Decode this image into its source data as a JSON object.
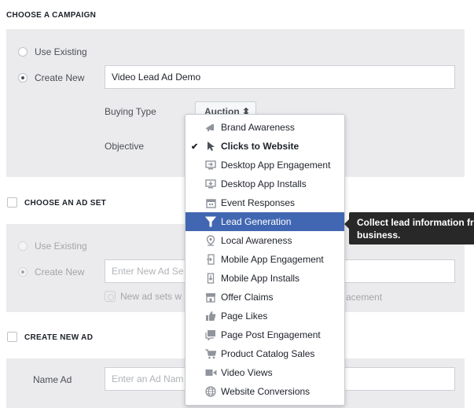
{
  "campaign": {
    "title": "CHOOSE A CAMPAIGN",
    "use_existing": "Use Existing",
    "create_new": "Create New",
    "name_value": "Video Lead Ad Demo",
    "buying_type_label": "Buying Type",
    "buying_type_value": "Auction ⬍",
    "objective_label": "Objective"
  },
  "adset": {
    "title": "CHOOSE AN AD SET",
    "use_existing": "Use Existing",
    "create_new": "Create New",
    "name_placeholder": "Enter New Ad Se",
    "name_placeholder_tail": "",
    "note_left": "New ad sets w",
    "note_right": "acement"
  },
  "ad": {
    "title": "CREATE NEW AD",
    "name_label": "Name Ad",
    "name_placeholder": "Enter an Ad Nam"
  },
  "objectives": [
    {
      "label": "Brand Awareness",
      "icon": "megaphone-icon"
    },
    {
      "label": "Clicks to Website",
      "icon": "cursor-icon",
      "selected": true,
      "checkmark": "✔"
    },
    {
      "label": "Desktop App Engagement",
      "icon": "desktop-engage-icon"
    },
    {
      "label": "Desktop App Installs",
      "icon": "desktop-install-icon"
    },
    {
      "label": "Event Responses",
      "icon": "calendar-icon"
    },
    {
      "label": "Lead Generation",
      "icon": "funnel-icon",
      "active": true
    },
    {
      "label": "Local Awareness",
      "icon": "pin-icon"
    },
    {
      "label": "Mobile App Engagement",
      "icon": "mobile-engage-icon"
    },
    {
      "label": "Mobile App Installs",
      "icon": "mobile-install-icon"
    },
    {
      "label": "Offer Claims",
      "icon": "store-icon"
    },
    {
      "label": "Page Likes",
      "icon": "thumbs-up-icon"
    },
    {
      "label": "Page Post Engagement",
      "icon": "post-icon"
    },
    {
      "label": "Product Catalog Sales",
      "icon": "cart-icon"
    },
    {
      "label": "Video Views",
      "icon": "video-icon"
    },
    {
      "label": "Website Conversions",
      "icon": "globe-icon"
    }
  ],
  "tooltip": {
    "line1": "Collect lead information fro",
    "line2": "business."
  },
  "colors": {
    "accent": "#4267b2",
    "panel": "#ebebed",
    "tooltip": "#282828"
  }
}
